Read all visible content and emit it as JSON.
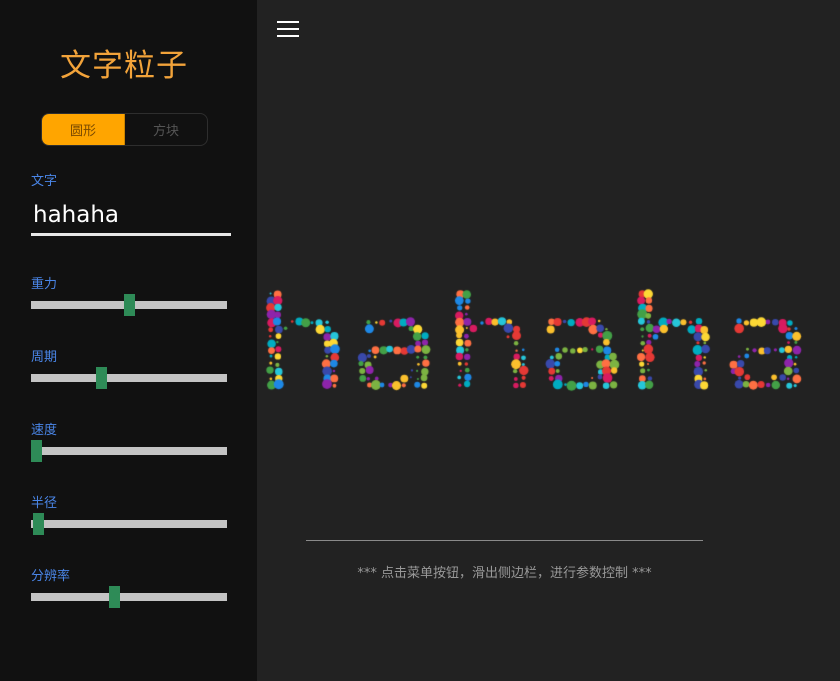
{
  "sidebar": {
    "title": "文字粒子",
    "shape_toggle": {
      "options": [
        "圆形",
        "方块"
      ],
      "selected": "圆形"
    },
    "text_field": {
      "label": "文字",
      "value": "hahaha"
    },
    "sliders": [
      {
        "label": "重力",
        "value_fraction": 0.5
      },
      {
        "label": "周期",
        "value_fraction": 0.35
      },
      {
        "label": "速度",
        "value_fraction": 0.0
      },
      {
        "label": "半径",
        "value_fraction": 0.01
      },
      {
        "label": "分辨率",
        "value_fraction": 0.42
      }
    ]
  },
  "main": {
    "menu_icon": "hamburger-menu-icon",
    "canvas_text": "hahaha",
    "particle_colors": [
      "#e53935",
      "#fbc02d",
      "#43a047",
      "#1e88e5",
      "#8e24aa",
      "#00acc1",
      "#ff7043",
      "#7cb342",
      "#3949ab",
      "#fdd835",
      "#d81b60",
      "#26c6da"
    ],
    "hint": "*** 点击菜单按钮，滑出侧边栏，进行参数控制 ***"
  }
}
